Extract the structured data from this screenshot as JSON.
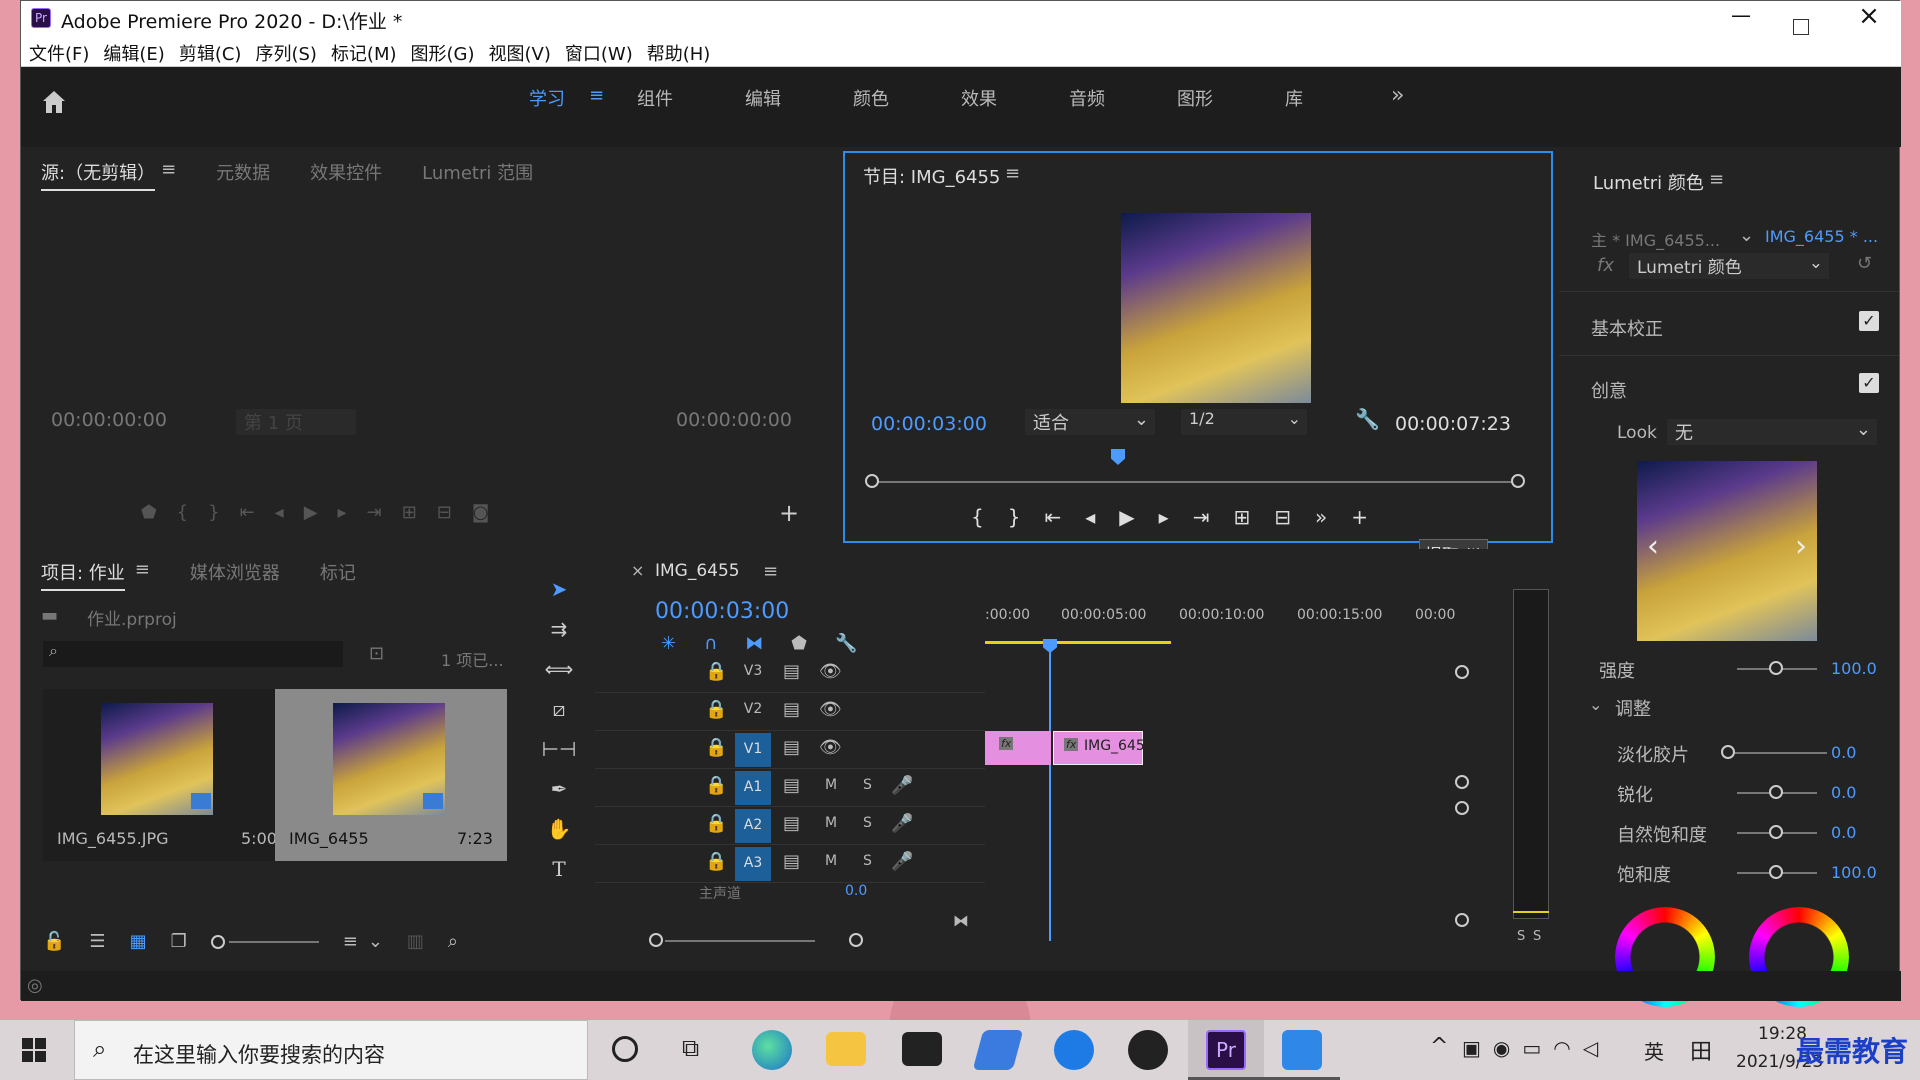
{
  "window": {
    "title": "Adobe Premiere Pro 2020 - D:\\作业 *",
    "app_badge": "Pr"
  },
  "menu": [
    "文件(F)",
    "编辑(E)",
    "剪辑(C)",
    "序列(S)",
    "标记(M)",
    "图形(G)",
    "视图(V)",
    "窗口(W)",
    "帮助(H)"
  ],
  "workspaces": [
    {
      "label": "学习",
      "active": true
    },
    {
      "label": "组件"
    },
    {
      "label": "编辑"
    },
    {
      "label": "颜色"
    },
    {
      "label": "效果"
    },
    {
      "label": "音频"
    },
    {
      "label": "图形"
    },
    {
      "label": "库"
    }
  ],
  "source": {
    "tabs": [
      "源:（无剪辑）",
      "元数据",
      "效果控件",
      "Lumetri 范围"
    ],
    "tc_left": "00:00:00:00",
    "tc_right": "00:00:00:00",
    "page": "第 1 页"
  },
  "program": {
    "title": "节目: IMG_6455",
    "tc_current": "00:00:03:00",
    "fit": "适合",
    "res": "1/2",
    "tc_duration": "00:00:07:23",
    "tooltip": "提取 (')"
  },
  "lumetri": {
    "title": "Lumetri 颜色",
    "master": "主 * IMG_6455...",
    "clip": "IMG_6455 * ...",
    "effect": "Lumetri 颜色",
    "basic": "基本校正",
    "creative": "创意",
    "look_label": "Look",
    "look_value": "无",
    "intensity_label": "强度",
    "intensity_value": "100.0",
    "adjust_label": "调整",
    "params": [
      {
        "label": "淡化胶片",
        "value": "0.0"
      },
      {
        "label": "锐化",
        "value": "0.0"
      },
      {
        "label": "自然饱和度",
        "value": "0.0"
      },
      {
        "label": "饱和度",
        "value": "100.0"
      }
    ]
  },
  "project": {
    "tabs": [
      "项目: 作业",
      "媒体浏览器",
      "标记"
    ],
    "file": "作业.prproj",
    "count": "1 项已...",
    "items": [
      {
        "name": "IMG_6455.JPG",
        "duration": "5:00"
      },
      {
        "name": "IMG_6455",
        "duration": "7:23"
      }
    ]
  },
  "timeline": {
    "seq": "IMG_6455",
    "tc": "00:00:03:00",
    "ruler": [
      ":00:00",
      "00:00:05:00",
      "00:00:10:00",
      "00:00:15:00",
      "00:00"
    ],
    "video_tracks": [
      "V3",
      "V2",
      "V1"
    ],
    "audio_tracks": [
      "A1",
      "A2",
      "A3"
    ],
    "master_label": "主声道",
    "master_value": "0.0",
    "clip_label": "IMG_645",
    "fx": "fx",
    "m": "M",
    "s": "S"
  },
  "meter": {
    "labels": [
      "S",
      "S"
    ]
  },
  "taskbar": {
    "search_placeholder": "在这里输入你要搜索的内容",
    "time": "19:28",
    "date": "2021/9/23",
    "lang": "英",
    "watermark": "最需教育"
  }
}
